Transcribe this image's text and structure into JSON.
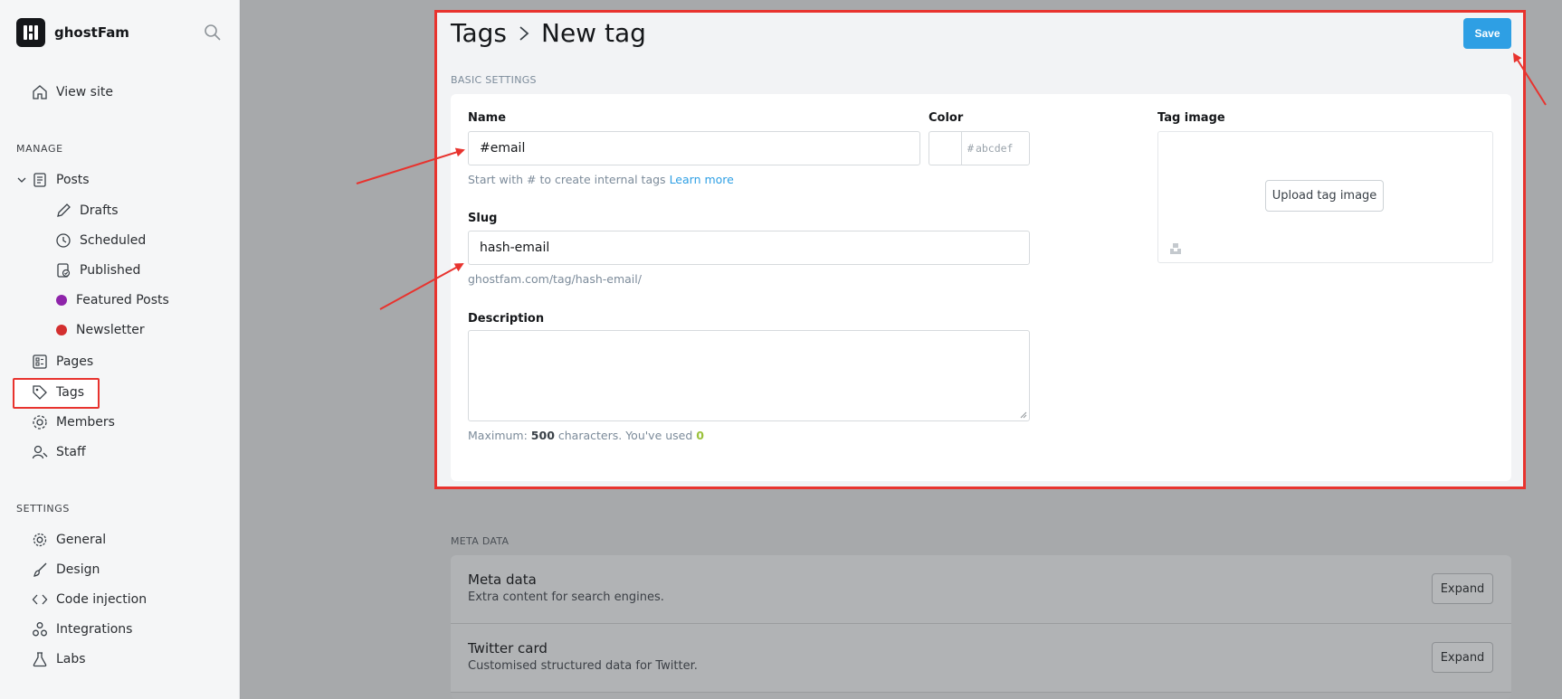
{
  "app": {
    "site_name": "ghostFam"
  },
  "sidebar": {
    "view_site": "View site",
    "manage_label": "MANAGE",
    "posts": "Posts",
    "drafts": "Drafts",
    "scheduled": "Scheduled",
    "published": "Published",
    "featured_posts": "Featured Posts",
    "newsletter": "Newsletter",
    "pages": "Pages",
    "tags": "Tags",
    "members": "Members",
    "staff": "Staff",
    "settings_label": "SETTINGS",
    "general": "General",
    "design": "Design",
    "code_injection": "Code injection",
    "integrations": "Integrations",
    "labs": "Labs",
    "colors": {
      "featured_dot": "#8e24aa",
      "newsletter_dot": "#d32f2f"
    }
  },
  "header": {
    "breadcrumb_parent": "Tags",
    "title": "New tag",
    "save_label": "Save"
  },
  "basic": {
    "section_label": "BASIC SETTINGS",
    "name_label": "Name",
    "name_value": "#email",
    "name_hint": "Start with # to create internal tags",
    "learn_more": "Learn more",
    "color_label": "Color",
    "color_hash": "#",
    "color_placeholder": "abcdef",
    "slug_label": "Slug",
    "slug_value": "hash-email",
    "slug_url": "ghostfam.com/tag/hash-email/",
    "description_label": "Description",
    "desc_hint_prefix": "Maximum:",
    "desc_max": "500",
    "desc_hint_mid": "characters. You've used",
    "desc_used": "0",
    "tag_image_label": "Tag image",
    "upload_label": "Upload tag image"
  },
  "meta": {
    "section_label": "META DATA",
    "rows": [
      {
        "title": "Meta data",
        "subtitle": "Extra content for search engines.",
        "button": "Expand"
      },
      {
        "title": "Twitter card",
        "subtitle": "Customised structured data for Twitter.",
        "button": "Expand"
      }
    ]
  },
  "accent": {
    "primary": "#2e9fe4",
    "annotation": "#e8332e"
  }
}
